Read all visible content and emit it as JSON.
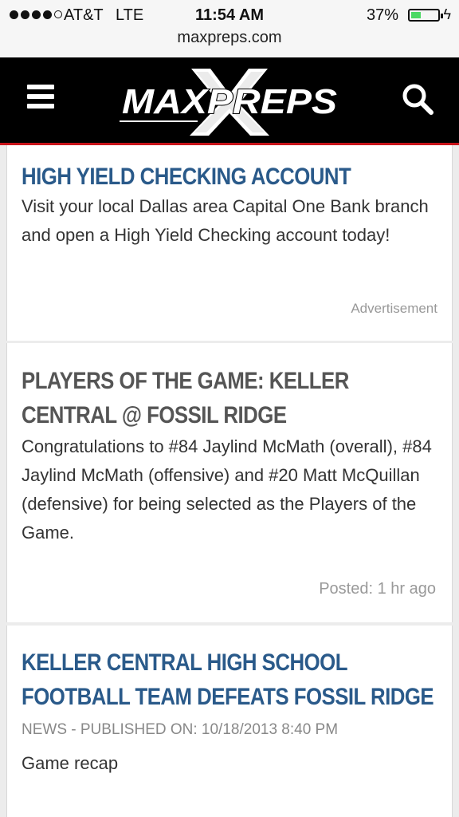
{
  "status_bar": {
    "carrier": "AT&T",
    "network": "LTE",
    "time": "11:54 AM",
    "battery_percent": "37%",
    "battery_level": 0.37,
    "signal_bars": 4
  },
  "browser": {
    "url": "maxpreps.com"
  },
  "header": {
    "logo_text": "MAXPREPS"
  },
  "ad": {
    "title": "HIGH YIELD CHECKING ACCOUNT",
    "body": "Visit your local Dallas area Capital One Bank branch and open a High Yield Checking account today!",
    "label": "Advertisement"
  },
  "players_card": {
    "title_line1": "PLAYERS OF THE GAME: KELLER",
    "title_line2": "CENTRAL @ FOSSIL RIDGE",
    "body": "Congratulations to #84 Jaylind McMath (overall), #84 Jaylind McMath (offensive) and #20 Matt McQuillan (defensive) for being selected as the Players of the Game.",
    "posted": "Posted: 1 hr ago"
  },
  "news_card": {
    "title_line1": "KELLER CENTRAL HIGH SCHOOL",
    "title_line2": "FOOTBALL TEAM DEFEATS FOSSIL RIDGE",
    "meta": "NEWS - PUBLISHED ON: 10/18/2013 8:40 PM",
    "body": "Game recap"
  },
  "colors": {
    "headline_blue": "#2a5a8a",
    "header_bg": "#000000",
    "header_accent": "#c8141a"
  }
}
